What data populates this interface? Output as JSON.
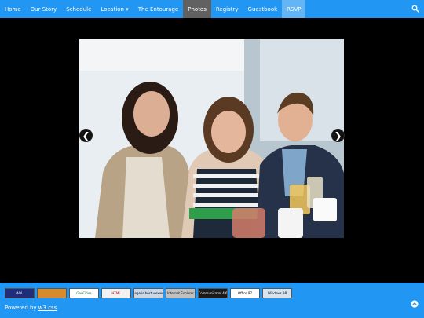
{
  "nav": {
    "items": [
      {
        "label": "Home"
      },
      {
        "label": "Our Story"
      },
      {
        "label": "Schedule"
      },
      {
        "label": "Location ▾"
      },
      {
        "label": "The Entourage"
      },
      {
        "label": "Photos"
      },
      {
        "label": "Registry"
      },
      {
        "label": "Guestbook"
      },
      {
        "label": "RSVP"
      }
    ],
    "search_icon": "search-icon"
  },
  "slideshow": {
    "prev_label": "❮",
    "next_label": "❯"
  },
  "footer": {
    "badges": [
      {
        "name": "aol-badge",
        "label": "AOL"
      },
      {
        "name": "badge-2",
        "label": ""
      },
      {
        "name": "geocities-badge",
        "label": "GeoCities"
      },
      {
        "name": "html-badge",
        "label": "HTML"
      },
      {
        "name": "best-viewed-badge",
        "label": "This page is best viewed with"
      },
      {
        "name": "internet-explorer-badge",
        "label": "Internet Explorer"
      },
      {
        "name": "communicator-badge",
        "label": "Communicator 4.6"
      },
      {
        "name": "office-badge",
        "label": "Office 97"
      },
      {
        "name": "windows-badge",
        "label": "Windows 98"
      }
    ],
    "powered_prefix": "Powered by ",
    "powered_link": "w3.css"
  },
  "colors": {
    "nav_bg": "#2196F3",
    "active_bg": "#616161",
    "rsvp_bg": "#64B5F6",
    "stage_bg": "#000000"
  }
}
